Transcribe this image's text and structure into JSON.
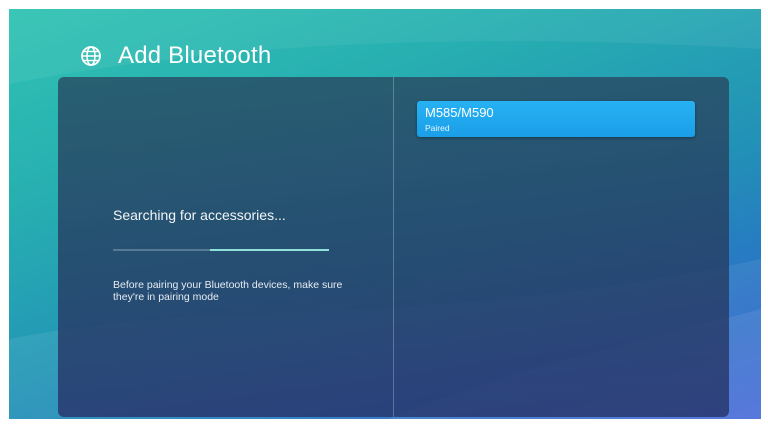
{
  "header": {
    "title": "Add Bluetooth",
    "icon": "globe-icon"
  },
  "search": {
    "status_text": "Searching for accessories...",
    "progress_start": 0.45,
    "progress_end": 1.0,
    "hint": "Before pairing your Bluetooth devices, make sure they're in pairing mode"
  },
  "devices": [
    {
      "name": "M585/M590",
      "status": "Paired"
    }
  ],
  "colors": {
    "accent": "#1a9ee8",
    "progress": "#8fe0d9"
  }
}
